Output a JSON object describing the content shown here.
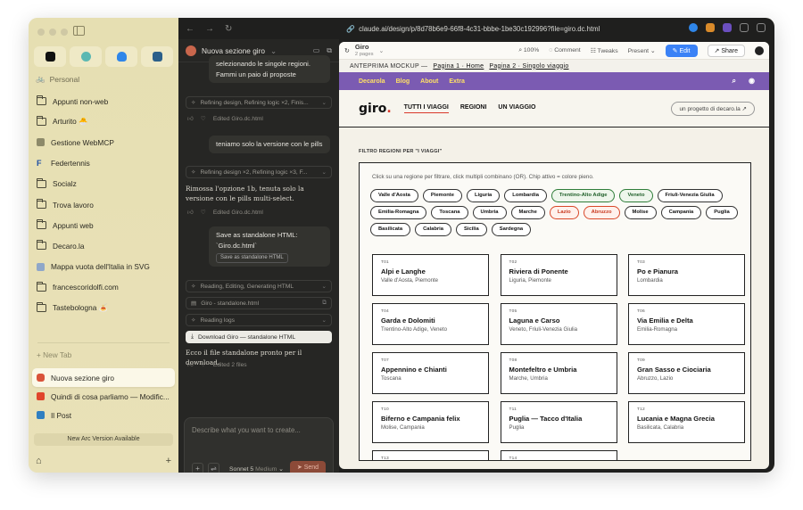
{
  "sidebar": {
    "space_label": "Personal",
    "items": [
      {
        "label": "Appunti non-web",
        "icon": "folder-icon"
      },
      {
        "label": "Arturito 🐣",
        "icon": "folder-icon"
      },
      {
        "label": "Gestione WebMCP",
        "icon": "app-icon"
      },
      {
        "label": "Federtennis",
        "icon": "federtennis-icon"
      },
      {
        "label": "Socialz",
        "icon": "folder-icon"
      },
      {
        "label": "Trova lavoro",
        "icon": "folder-icon"
      },
      {
        "label": "Appunti web",
        "icon": "folder-icon"
      },
      {
        "label": "Decaro.la",
        "icon": "folder-icon"
      },
      {
        "label": "Mappa vuota dell'Italia in SVG",
        "icon": "page-icon"
      },
      {
        "label": "francescoridolfi.com",
        "icon": "folder-icon"
      },
      {
        "label": "Tastebologna 🍝",
        "icon": "folder-icon"
      }
    ],
    "new_tab": "+ New Tab",
    "tabs": [
      {
        "label": "Nuova sezione giro",
        "active": true,
        "color": "#d9533a"
      },
      {
        "label": "Quindi di cosa parliamo — Modific...",
        "active": false,
        "color": "#e0452c"
      },
      {
        "label": "Il Post",
        "active": false,
        "color": "#2f7fc1"
      }
    ],
    "update_label": "New Arc Version Available"
  },
  "browser": {
    "url": "claude.ai/design/p/8d78b6e9-66f8-4c31-bbbe-1be30c192996?file=giro.dc.html"
  },
  "chat": {
    "title": "Nuova sezione giro",
    "msg_top": "selezionando le singole regioni. Fammi un paio di proposte",
    "tool1": "Refining design, Refining logic ×2, Finis...",
    "edited1": "Edited Giro.dc.html",
    "msg_user2": "teniamo solo la versione con le pills",
    "tool2": "Refining design ×2, Refining logic ×3, F...",
    "assist1": "Rimossa l'opzione 1b, tenuta solo la versione con le pills multi-select.",
    "edited2": "Edited Giro.dc.html",
    "msg_user3": "Save as standalone HTML: `Giro.dc.html`",
    "msg_user3_tag": "Save as standalone HTML",
    "tool3": "Reading, Editing, Generating HTML",
    "file_row": "Giro - standalone.html",
    "tool4": "Reading logs",
    "download": "Download Giro — standalone HTML",
    "assist2": "Ecco il file standalone pronto per il download.",
    "edited3": "Edited 2 files",
    "composer_placeholder": "Describe what you want to create...",
    "model": "Sonnet 5",
    "model_mode": "Medium",
    "send": "Send"
  },
  "preview": {
    "title": "Giro",
    "pages": "2 pages",
    "zoom": "100%",
    "comment": "Comment",
    "tweaks": "Tweaks",
    "present": "Present",
    "edit": "Edit",
    "share": "Share",
    "anteprima": "ANTEPRIMA MOCKUP —",
    "page1": "Pagina 1 · Home",
    "page2": "Pagina 2 · Singolo viaggio",
    "purple_nav": [
      "Decarola",
      "Blog",
      "About",
      "Extra"
    ],
    "logo": "giro",
    "logo_dot": ".",
    "site_nav": [
      "TUTTI I VIAGGI",
      "REGIONI",
      "UN VIAGGIO"
    ],
    "project": "un progetto di decaro.la ↗",
    "filter_label": "FILTRO REGIONI PER \"I VIAGGI\"",
    "hint": "Click su una regione per filtrare, click multipli combinano (OR). Chip attivo = colore pieno.",
    "chips": [
      {
        "label": "Valle d'Aosta",
        "state": "off"
      },
      {
        "label": "Piemonte",
        "state": "off"
      },
      {
        "label": "Liguria",
        "state": "off"
      },
      {
        "label": "Lombardia",
        "state": "off"
      },
      {
        "label": "Trentino-Alto Adige",
        "state": "green"
      },
      {
        "label": "Veneto",
        "state": "green"
      },
      {
        "label": "Friuli-Venezia Giulia",
        "state": "off"
      },
      {
        "label": "Emilia-Romagna",
        "state": "off"
      },
      {
        "label": "Toscana",
        "state": "off"
      },
      {
        "label": "Umbria",
        "state": "off"
      },
      {
        "label": "Marche",
        "state": "off"
      },
      {
        "label": "Lazio",
        "state": "orange"
      },
      {
        "label": "Abruzzo",
        "state": "orange"
      },
      {
        "label": "Molise",
        "state": "off"
      },
      {
        "label": "Campania",
        "state": "off"
      },
      {
        "label": "Puglia",
        "state": "off"
      },
      {
        "label": "Basilicata",
        "state": "off"
      },
      {
        "label": "Calabria",
        "state": "off"
      },
      {
        "label": "Sicilia",
        "state": "off"
      },
      {
        "label": "Sardegna",
        "state": "off"
      }
    ],
    "cards": [
      {
        "num": "T01",
        "title": "Alpi e Langhe",
        "sub": "Valle d'Aosta, Piemonte"
      },
      {
        "num": "T02",
        "title": "Riviera di Ponente",
        "sub": "Liguria, Piemonte"
      },
      {
        "num": "T03",
        "title": "Po e Pianura",
        "sub": "Lombardia"
      },
      {
        "num": "T04",
        "title": "Garda e Dolomiti",
        "sub": "Trentino-Alto Adige, Veneto"
      },
      {
        "num": "T05",
        "title": "Laguna e Carso",
        "sub": "Veneto, Friuli-Venezia Giulia"
      },
      {
        "num": "T06",
        "title": "Via Emilia e Delta",
        "sub": "Emilia-Romagna"
      },
      {
        "num": "T07",
        "title": "Appennino e Chianti",
        "sub": "Toscana"
      },
      {
        "num": "T08",
        "title": "Montefeltro e Umbria",
        "sub": "Marche, Umbria"
      },
      {
        "num": "T09",
        "title": "Gran Sasso e Ciociaria",
        "sub": "Abruzzo, Lazio"
      },
      {
        "num": "T10",
        "title": "Biferno e Campania felix",
        "sub": "Molise, Campania"
      },
      {
        "num": "T11",
        "title": "Puglia — Tacco d'Italia",
        "sub": "Puglia"
      },
      {
        "num": "T12",
        "title": "Lucania e Magna Grecia",
        "sub": "Basilicata, Calabria"
      },
      {
        "num": "T13",
        "title": "",
        "sub": ""
      },
      {
        "num": "T14",
        "title": "",
        "sub": ""
      }
    ]
  }
}
